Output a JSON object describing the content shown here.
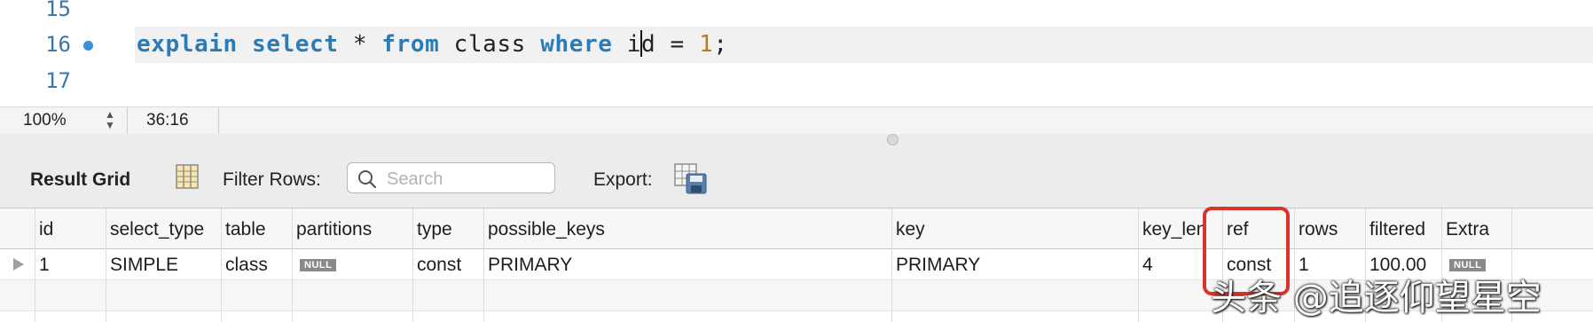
{
  "editor": {
    "lines": [
      {
        "number": "15",
        "code": ""
      },
      {
        "number": "16",
        "code": "explain select * from class where id = 1;"
      },
      {
        "number": "17",
        "code": ""
      }
    ],
    "tokens": {
      "explain": "explain",
      "select": "select",
      "star": "*",
      "from": "from",
      "table": "class",
      "where": "where",
      "col_a": "i",
      "col_b": "d",
      "eq": "=",
      "value": "1",
      "semi": ";"
    }
  },
  "statusbar": {
    "zoom": "100%",
    "cursor_position": "36:16"
  },
  "toolbar": {
    "result_grid_label": "Result Grid",
    "filter_rows_label": "Filter Rows:",
    "search_placeholder": "Search",
    "export_label": "Export:"
  },
  "grid": {
    "columns": [
      "id",
      "select_type",
      "table",
      "partitions",
      "type",
      "possible_keys",
      "key",
      "key_len",
      "ref",
      "rows",
      "filtered",
      "Extra"
    ],
    "rows": [
      [
        "1",
        "SIMPLE",
        "class",
        "NULL",
        "const",
        "PRIMARY",
        "PRIMARY",
        "4",
        "const",
        "1",
        "100.00",
        "NULL"
      ]
    ]
  },
  "colors": {
    "keyword": "#2c7bb6",
    "number": "#c07a16",
    "highlight_box": "#d9342b"
  },
  "watermark": "头条 @追逐仰望星空"
}
